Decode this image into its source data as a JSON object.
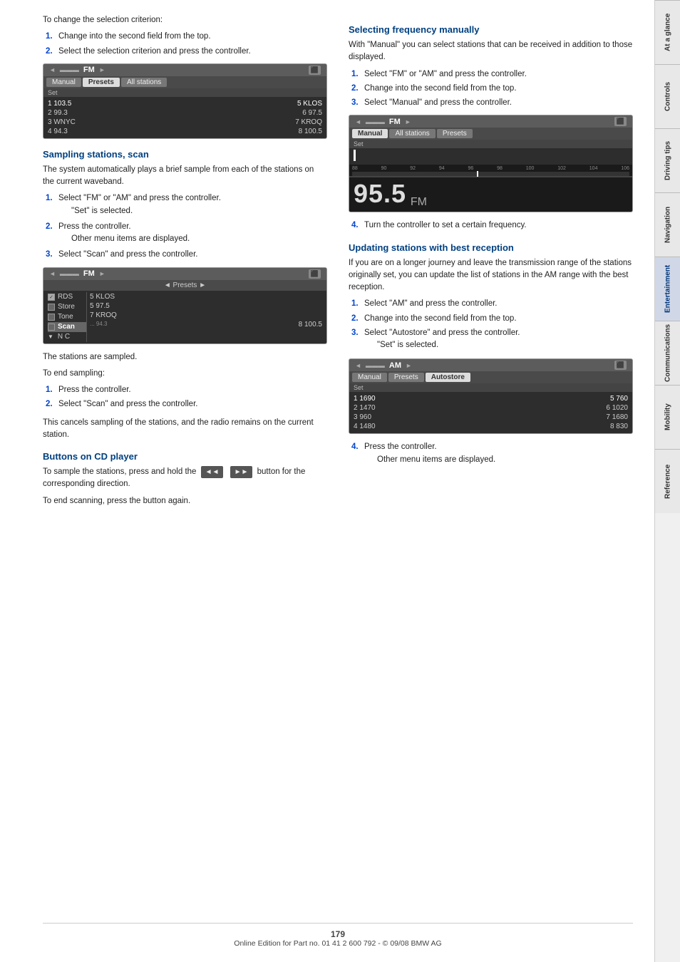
{
  "page": {
    "number": "179",
    "footer": "Online Edition for Part no. 01 41 2 600 792 - © 09/08 BMW AG"
  },
  "sidebar": {
    "tabs": [
      {
        "label": "At a glance",
        "active": false
      },
      {
        "label": "Controls",
        "active": false
      },
      {
        "label": "Driving tips",
        "active": false
      },
      {
        "label": "Navigation",
        "active": false
      },
      {
        "label": "Entertainment",
        "active": true
      },
      {
        "label": "Communications",
        "active": false
      },
      {
        "label": "Mobility",
        "active": false
      },
      {
        "label": "Reference",
        "active": false
      }
    ]
  },
  "left_col": {
    "intro_text": "To change the selection criterion:",
    "intro_steps": [
      {
        "num": "1.",
        "text": "Change into the second field from the top."
      },
      {
        "num": "2.",
        "text": "Select the selection criterion and press the controller."
      }
    ],
    "radio_ui_1": {
      "band": "FM",
      "tabs": [
        "Manual",
        "Presets",
        "All stations"
      ],
      "active_tab": "Presets",
      "set_label": "Set",
      "stations": [
        {
          "col1": "1 103.5",
          "col2": "5 KLOS"
        },
        {
          "col1": "2 99.3",
          "col2": "6 97.5"
        },
        {
          "col1": "3 WNYC",
          "col2": "7 KROQ"
        },
        {
          "col1": "4 94.3",
          "col2": "8 100.5"
        }
      ]
    },
    "section_scan": {
      "heading": "Sampling stations, scan",
      "body": "The system automatically plays a brief sample from each of the stations on the current waveband.",
      "steps": [
        {
          "num": "1.",
          "text": "Select \"FM\" or \"AM\" and press the controller.",
          "sub": "\"Set\" is selected."
        },
        {
          "num": "2.",
          "text": "Press the controller.",
          "sub": "Other menu items are displayed."
        },
        {
          "num": "3.",
          "text": "Select \"Scan\" and press the controller."
        }
      ]
    },
    "radio_ui_2": {
      "band": "FM",
      "tabs": [
        ""
      ],
      "presets_label": "◄ Presets ►",
      "menu_items": [
        {
          "icon": "checked",
          "label": "RDS",
          "val": ""
        },
        {
          "icon": "none",
          "label": "Store",
          "val": "5 KLOS"
        },
        {
          "icon": "none",
          "label": "Tone",
          "val": "5 97.5"
        },
        {
          "icon": "selected",
          "label": "Scan",
          "val": "7 KROQ"
        },
        {
          "icon": "none",
          "label": "",
          "val": "8 100.5"
        },
        {
          "icon": "none",
          "label": "N C",
          "col3": "8 100.5"
        }
      ],
      "stations_right": [
        "5 KLOS",
        "5 97.5",
        "7 KROQ",
        "8 100.5"
      ]
    },
    "after_scan": {
      "text1": "The stations are sampled.",
      "text2": "To end sampling:",
      "steps": [
        {
          "num": "1.",
          "text": "Press the controller."
        },
        {
          "num": "2.",
          "text": "Select \"Scan\" and press the controller."
        }
      ],
      "text3": "This cancels sampling of the stations, and the radio remains on the current station."
    },
    "section_buttons": {
      "heading": "Buttons on CD player",
      "text1": "To sample the stations, press and hold the",
      "button_symbol": "◄◄  ►►",
      "text2": "button for the corresponding direction.",
      "text3": "To end scanning, press the button again."
    }
  },
  "right_col": {
    "section_freq": {
      "heading": "Selecting frequency manually",
      "body": "With \"Manual\" you can select stations that can be received in addition to those displayed.",
      "steps": [
        {
          "num": "1.",
          "text": "Select \"FM\" or \"AM\" and press the controller."
        },
        {
          "num": "2.",
          "text": "Change into the second field from the top."
        },
        {
          "num": "3.",
          "text": "Select \"Manual\" and press the controller."
        }
      ]
    },
    "radio_ui_3": {
      "band": "FM",
      "tabs": [
        "Manual",
        "All stations",
        "Presets"
      ],
      "active_tab": "Manual",
      "set_label": "Set",
      "cursor": true,
      "freq_ruler": [
        "88",
        "90",
        "92",
        "94",
        "96",
        "98",
        "100",
        "102",
        "104",
        "106"
      ],
      "freq_display": "95.5",
      "freq_unit": "FM"
    },
    "step4_freq": {
      "num": "4.",
      "text": "Turn the controller to set a certain frequency."
    },
    "section_update": {
      "heading": "Updating stations with best reception",
      "body": "If you are on a longer journey and leave the transmission range of the stations originally set, you can update the list of stations in the AM range with the best reception.",
      "steps": [
        {
          "num": "1.",
          "text": "Select \"AM\" and press the controller."
        },
        {
          "num": "2.",
          "text": "Change into the second field from the top."
        },
        {
          "num": "3.",
          "text": "Select \"Autostore\" and press the controller.",
          "sub": "\"Set\" is selected."
        }
      ]
    },
    "radio_ui_4": {
      "band": "AM",
      "tabs": [
        "Manual",
        "Presets",
        "Autostore"
      ],
      "active_tab": "Autostore",
      "set_label": "Set",
      "stations": [
        {
          "col1": "1 1690",
          "col2": "5 760"
        },
        {
          "col1": "2 1470",
          "col2": "6 1020"
        },
        {
          "col1": "3 960",
          "col2": "7 1680"
        },
        {
          "col1": "4 1480",
          "col2": "8 830"
        }
      ]
    },
    "step4_update": {
      "num": "4.",
      "text": "Press the controller.",
      "sub": "Other menu items are displayed."
    }
  }
}
